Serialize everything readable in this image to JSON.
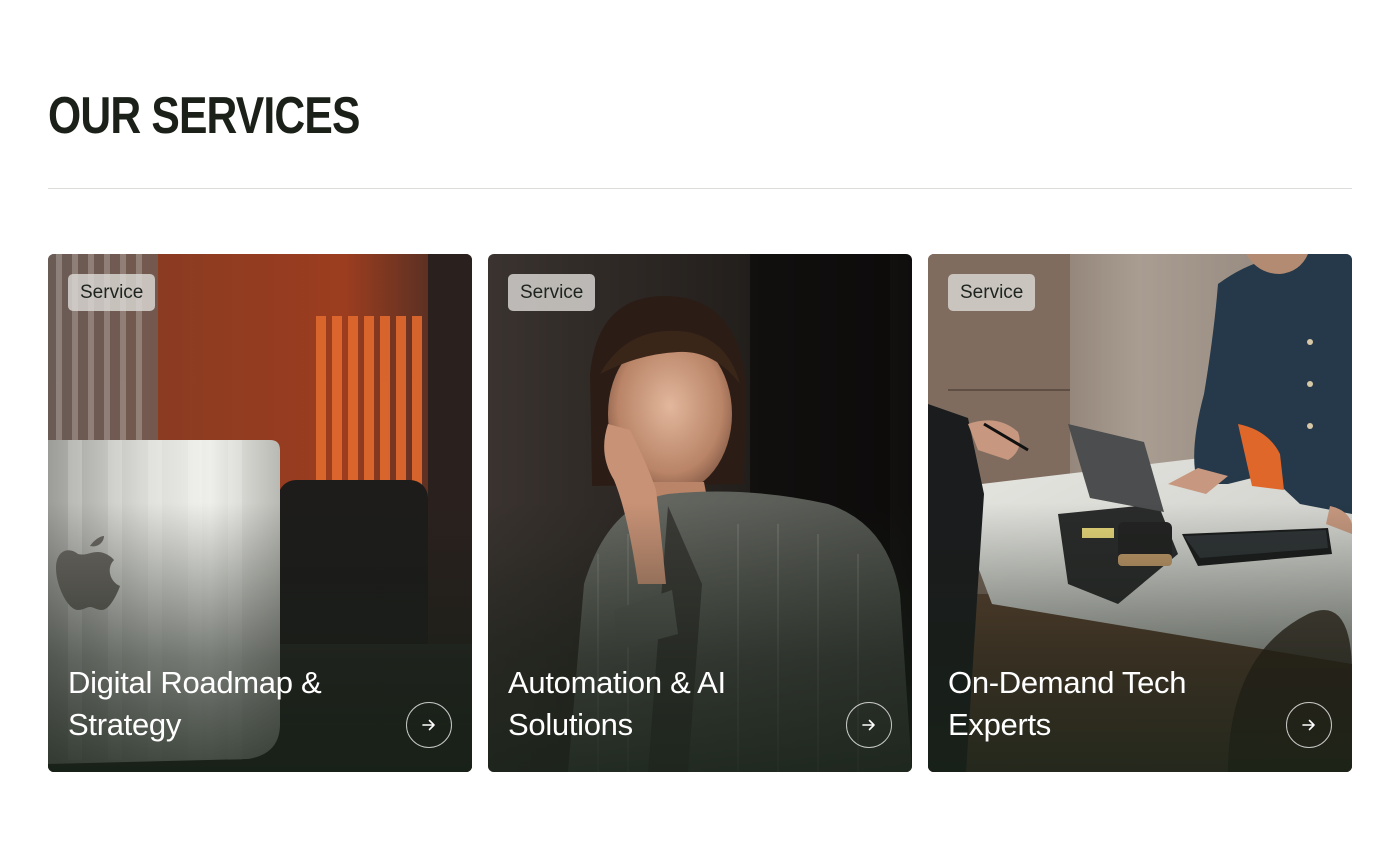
{
  "section": {
    "title": "OUR SERVICES"
  },
  "cards": [
    {
      "badge": "Service",
      "title": "Digital Roadmap & Strategy",
      "image": "laptop-by-orange-wall-photo",
      "arrow_icon": "arrow-right-icon"
    },
    {
      "badge": "Service",
      "title": "Automation & AI Solutions",
      "image": "smiling-woman-portrait-photo",
      "arrow_icon": "arrow-right-icon"
    },
    {
      "badge": "Service",
      "title": "On-Demand Tech Experts",
      "image": "team-meeting-table-photo",
      "arrow_icon": "arrow-right-icon"
    }
  ],
  "colors": {
    "heading": "#1b2119",
    "divider": "#dcdddb",
    "badge_bg": "#dad8d4",
    "card_text": "#ffffff"
  }
}
